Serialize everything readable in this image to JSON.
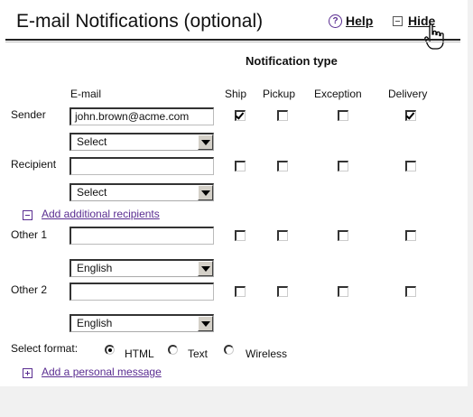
{
  "header": {
    "title": "E-mail Notifications (optional)",
    "help_label": "Help",
    "hide_label": "Hide"
  },
  "table": {
    "notification_type_label": "Notification type",
    "email_column_label": "E-mail",
    "columns": [
      "Ship",
      "Pickup",
      "Exception",
      "Delivery"
    ],
    "rows": [
      {
        "label": "Sender",
        "email_value": "john.brown@acme.com",
        "select_value": "Select",
        "checks": [
          true,
          false,
          false,
          true
        ]
      },
      {
        "label": "Recipient",
        "email_value": "",
        "select_value": "Select",
        "checks": [
          false,
          false,
          false,
          false
        ]
      },
      {
        "label": "Other 1",
        "email_value": "",
        "select_value": "English",
        "checks": [
          false,
          false,
          false,
          false
        ]
      },
      {
        "label": "Other 2",
        "email_value": "",
        "select_value": "English",
        "checks": [
          false,
          false,
          false,
          false
        ]
      }
    ],
    "add_recipients_label": "Add additional recipients"
  },
  "format": {
    "label": "Select format:",
    "options": [
      "HTML",
      "Text",
      "Wireless"
    ],
    "selected": "HTML"
  },
  "personal_message_label": "Add a personal message",
  "icons": {
    "help": "help-circle-icon",
    "hide": "collapse-minus-icon",
    "cursor": "hand-pointer-icon",
    "add_recipients": "collapse-minus-icon",
    "personal_message": "expand-plus-icon"
  },
  "colors": {
    "accent": "#5a2d91",
    "text": "#111111"
  }
}
